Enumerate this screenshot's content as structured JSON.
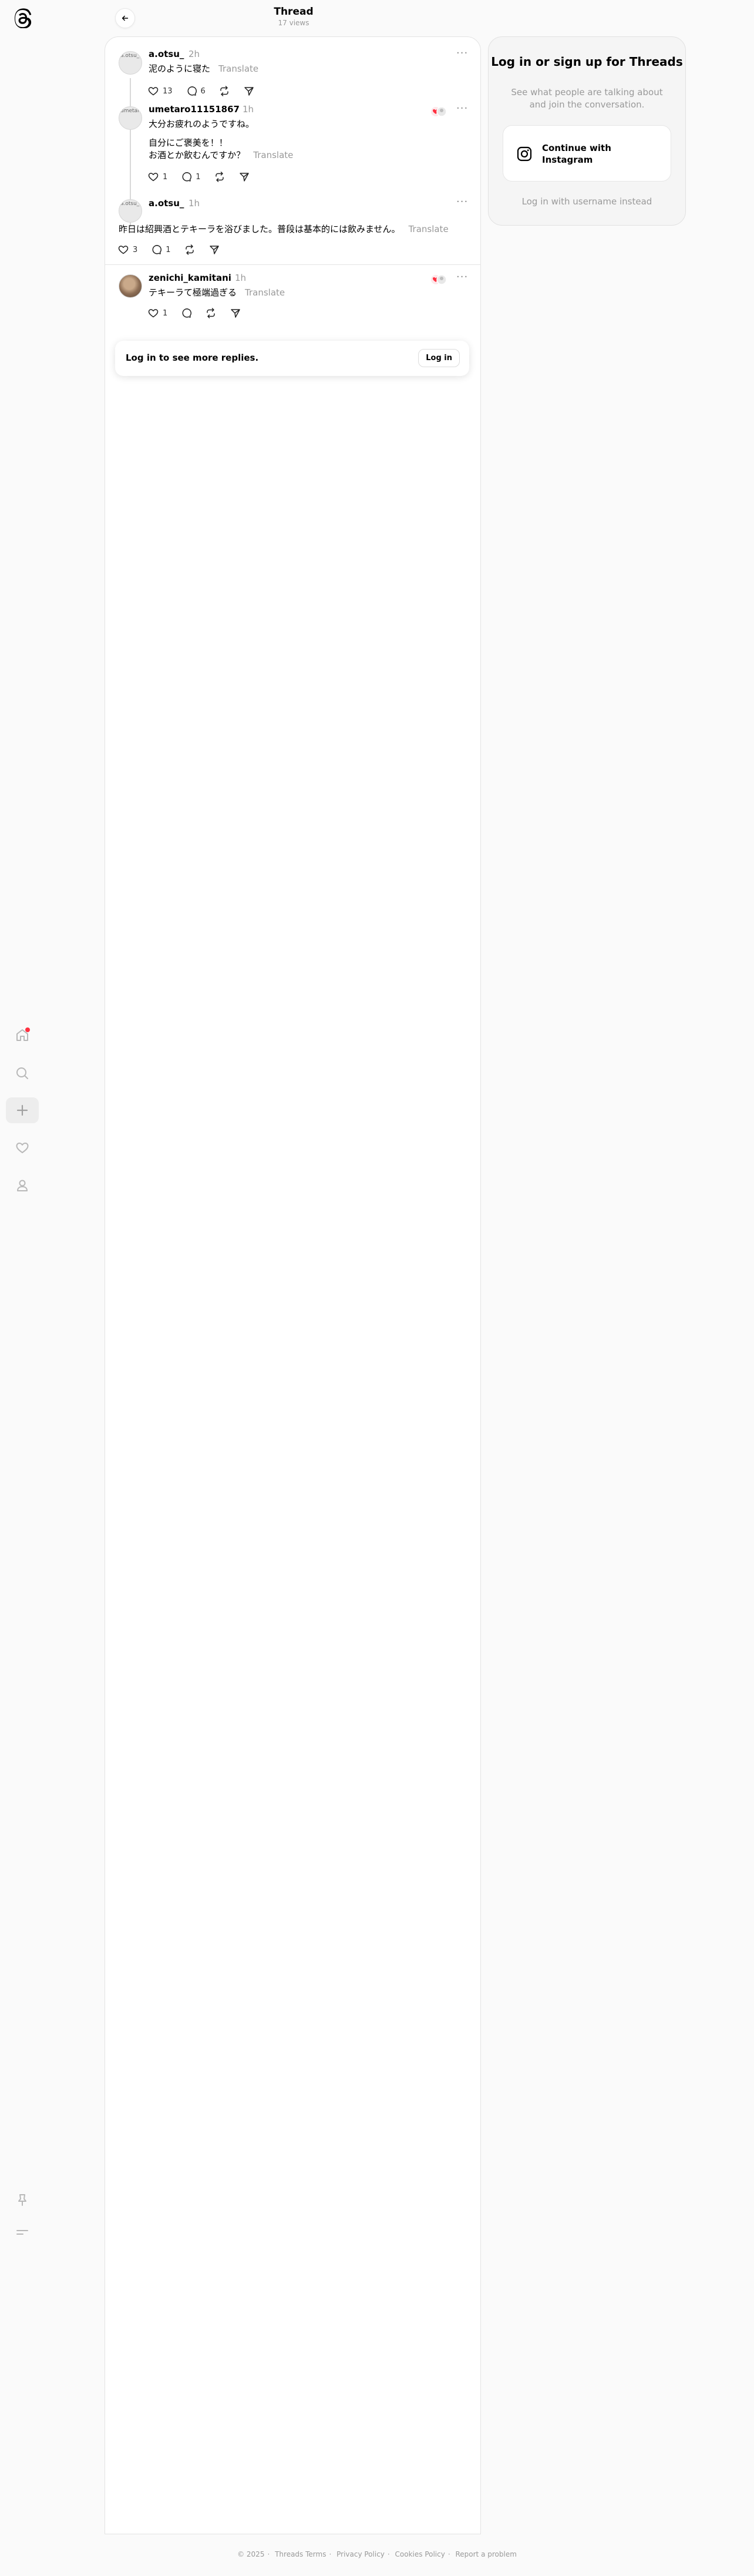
{
  "header": {
    "title": "Thread",
    "views": "17 views"
  },
  "posts": [
    {
      "username": "a.otsu_",
      "avatar_alt": "a.otsu_",
      "time": "2h",
      "text": "泥のように寝た",
      "translate": "Translate",
      "likes": "13",
      "replies": "6",
      "more": "···"
    },
    {
      "username": "umetaro11151867",
      "avatar_alt": "umetaro11151867",
      "time": "1h",
      "text_line1": "大分お疲れのようですね。",
      "text_line2": "自分にご褒美を！！",
      "text_line3": "お酒とか飲むんですか？",
      "translate": "Translate",
      "likes": "1",
      "replies": "1",
      "more": "···"
    },
    {
      "username": "a.otsu_",
      "avatar_alt": "a.otsu_",
      "time": "1h",
      "text": "昨日は紹興酒とテキーラを浴びました。普段は基本的には飲みません。",
      "translate": "Translate",
      "likes": "3",
      "replies": "1",
      "more": "···"
    },
    {
      "username": "zenichi_kamitani",
      "time": "1h",
      "text": "テキーラて極端過ぎる",
      "translate": "Translate",
      "likes": "1",
      "more": "···"
    }
  ],
  "login_bar": {
    "text": "Log in to see more replies.",
    "button": "Log in"
  },
  "side_card": {
    "title": "Log in or sign up for Threads",
    "subtitle": "See what people are talking about and join the conversation.",
    "instagram_button": "Continue with Instagram",
    "alt_login": "Log in with username instead"
  },
  "footer": {
    "copyright": "© 2025",
    "links": [
      "Threads Terms",
      "Privacy Policy",
      "Cookies Policy",
      "Report a problem"
    ]
  },
  "colors": {
    "accent_dot": "#ff3040",
    "muted": "#999999"
  }
}
